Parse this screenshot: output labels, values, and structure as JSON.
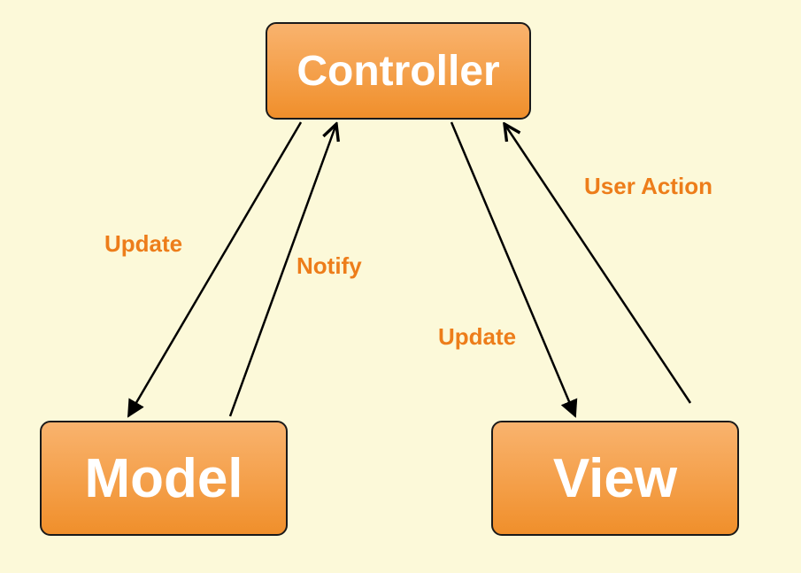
{
  "diagram": {
    "nodes": {
      "controller": "Controller",
      "model": "Model",
      "view": "View"
    },
    "edges": {
      "controller_to_model": "Update",
      "model_to_controller": "Notify",
      "controller_to_view": "Update",
      "view_to_controller": "User Action"
    },
    "colors": {
      "background": "#fcf9d9",
      "node_fill_top": "#f9b36e",
      "node_fill_bottom": "#f08f2b",
      "node_border": "#1a1a1a",
      "node_text": "#ffffff",
      "edge_label": "#ed7d1a",
      "arrow": "#000000"
    }
  }
}
